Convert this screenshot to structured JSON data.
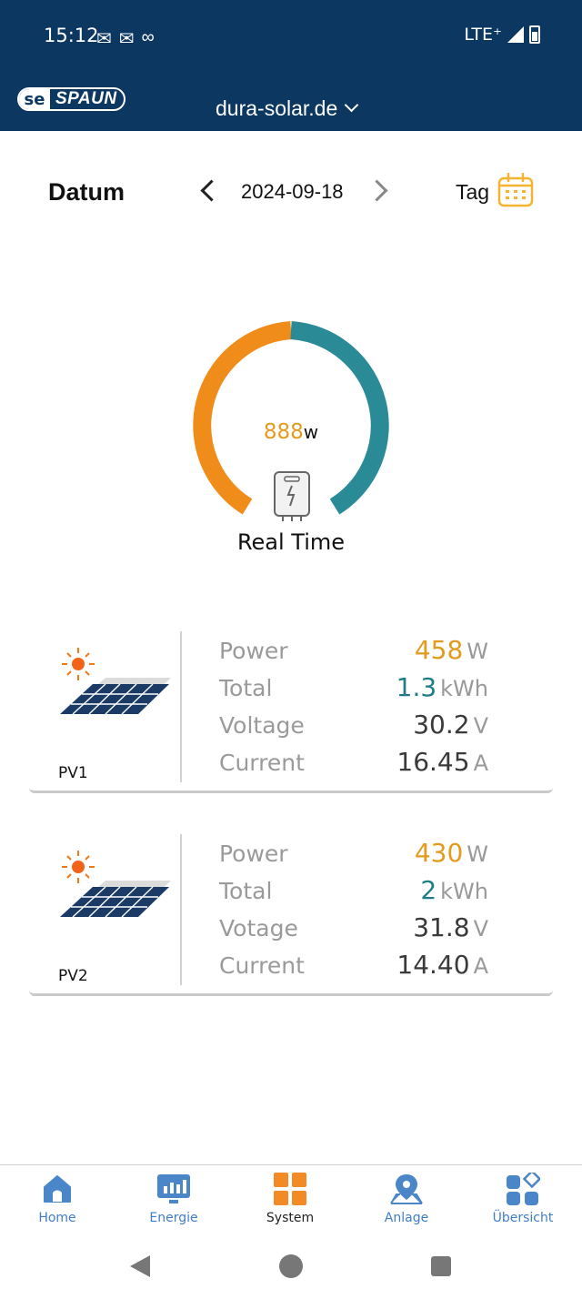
{
  "status_bar": {
    "time": "15:12",
    "network": "LTE⁺"
  },
  "header": {
    "logo_mark": "se",
    "logo_text": "SPAUN",
    "site": "dura-solar.de"
  },
  "date_row": {
    "label": "Datum",
    "date": "2024-09-18",
    "period": "Tag"
  },
  "gauge": {
    "value": "888",
    "unit": "w",
    "label": "Real Time",
    "colors": {
      "left": "#f08c1a",
      "right": "#2a8a96"
    }
  },
  "pv_cards": [
    {
      "name": "PV1",
      "rows": [
        {
          "label": "Power",
          "value": "458",
          "unit": "W",
          "color": "orange"
        },
        {
          "label": "Total",
          "value": "1.3",
          "unit": "kWh",
          "color": "teal"
        },
        {
          "label": "Voltage",
          "value": "30.2",
          "unit": "V",
          "color": "dark"
        },
        {
          "label": "Current",
          "value": "16.45",
          "unit": "A",
          "color": "dark"
        }
      ]
    },
    {
      "name": "PV2",
      "rows": [
        {
          "label": "Power",
          "value": "430",
          "unit": "W",
          "color": "orange"
        },
        {
          "label": "Total",
          "value": "2",
          "unit": "kWh",
          "color": "teal"
        },
        {
          "label": "Votage",
          "value": "31.8",
          "unit": "V",
          "color": "dark"
        },
        {
          "label": "Current",
          "value": "14.40",
          "unit": "A",
          "color": "dark"
        }
      ]
    }
  ],
  "bottom_nav": [
    {
      "label": "Home",
      "icon": "home-icon",
      "active": false
    },
    {
      "label": "Energie",
      "icon": "energy-chart-icon",
      "active": false
    },
    {
      "label": "System",
      "icon": "system-grid-icon",
      "active": true
    },
    {
      "label": "Anlage",
      "icon": "location-pin-icon",
      "active": false
    },
    {
      "label": "Übersicht",
      "icon": "overview-icon",
      "active": false
    }
  ],
  "accent_colors": {
    "header": "#0b3760",
    "orange": "#e39b1f",
    "teal": "#1f7d8a",
    "nav_blue": "#3f7fc8"
  }
}
